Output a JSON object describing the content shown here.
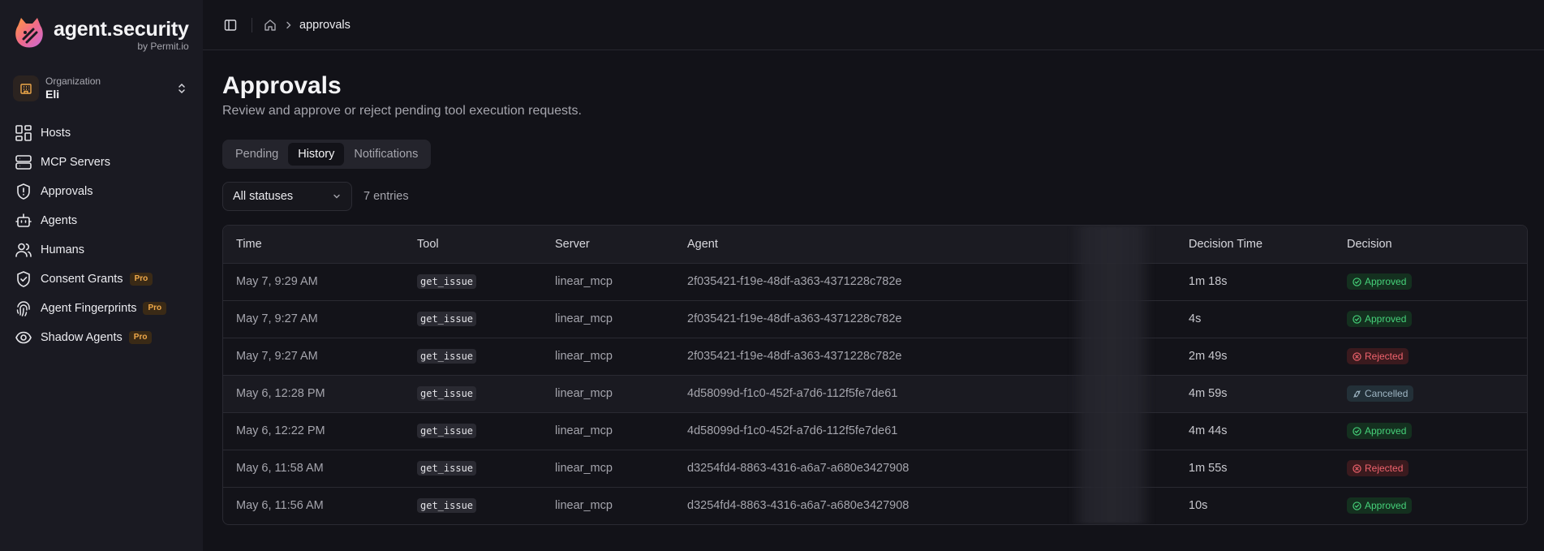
{
  "brand": {
    "name": "agent.security",
    "sub": "by Permit.io"
  },
  "org": {
    "label": "Organization",
    "name": "Eli"
  },
  "nav": [
    {
      "label": "Hosts",
      "icon": "grid-icon",
      "pro": false
    },
    {
      "label": "MCP Servers",
      "icon": "server-icon",
      "pro": false
    },
    {
      "label": "Approvals",
      "icon": "shield-alert-icon",
      "pro": false
    },
    {
      "label": "Agents",
      "icon": "bot-icon",
      "pro": false
    },
    {
      "label": "Humans",
      "icon": "users-icon",
      "pro": false
    },
    {
      "label": "Consent Grants",
      "icon": "shield-check-icon",
      "pro": true
    },
    {
      "label": "Agent Fingerprints",
      "icon": "fingerprint-icon",
      "pro": true
    },
    {
      "label": "Shadow Agents",
      "icon": "eye-icon",
      "pro": true
    }
  ],
  "pro_label": "Pro",
  "breadcrumb": {
    "current": "approvals"
  },
  "page": {
    "title": "Approvals",
    "subtitle": "Review and approve or reject pending tool execution requests."
  },
  "tabs": [
    {
      "label": "Pending",
      "active": false
    },
    {
      "label": "History",
      "active": true
    },
    {
      "label": "Notifications",
      "active": false
    }
  ],
  "filter": {
    "status_selected": "All statuses",
    "entries": "7 entries"
  },
  "table": {
    "columns": [
      "Time",
      "Tool",
      "Server",
      "Agent",
      "",
      "Decision Time",
      "Decision"
    ],
    "rows": [
      {
        "time": "May 7, 9:29 AM",
        "tool": "get_issue",
        "server": "linear_mcp",
        "agent": "2f035421-f19e-48df-a363-4371228c782e",
        "decision_time": "1m 18s",
        "decision": "Approved"
      },
      {
        "time": "May 7, 9:27 AM",
        "tool": "get_issue",
        "server": "linear_mcp",
        "agent": "2f035421-f19e-48df-a363-4371228c782e",
        "decision_time": "4s",
        "decision": "Approved"
      },
      {
        "time": "May 7, 9:27 AM",
        "tool": "get_issue",
        "server": "linear_mcp",
        "agent": "2f035421-f19e-48df-a363-4371228c782e",
        "decision_time": "2m 49s",
        "decision": "Rejected"
      },
      {
        "time": "May 6, 12:28 PM",
        "tool": "get_issue",
        "server": "linear_mcp",
        "agent": "4d58099d-f1c0-452f-a7d6-112f5fe7de61",
        "decision_time": "4m 59s",
        "decision": "Cancelled"
      },
      {
        "time": "May 6, 12:22 PM",
        "tool": "get_issue",
        "server": "linear_mcp",
        "agent": "4d58099d-f1c0-452f-a7d6-112f5fe7de61",
        "decision_time": "4m 44s",
        "decision": "Approved"
      },
      {
        "time": "May 6, 11:58 AM",
        "tool": "get_issue",
        "server": "linear_mcp",
        "agent": "d3254fd4-8863-4316-a6a7-a680e3427908",
        "decision_time": "1m 55s",
        "decision": "Rejected"
      },
      {
        "time": "May 6, 11:56 AM",
        "tool": "get_issue",
        "server": "linear_mcp",
        "agent": "d3254fd4-8863-4316-a6a7-a680e3427908",
        "decision_time": "10s",
        "decision": "Approved"
      }
    ]
  },
  "colors": {
    "accent_orange": "#f0a94a",
    "approved": "#46d27a",
    "rejected": "#f0636d",
    "cancelled": "#9fb6c4"
  }
}
